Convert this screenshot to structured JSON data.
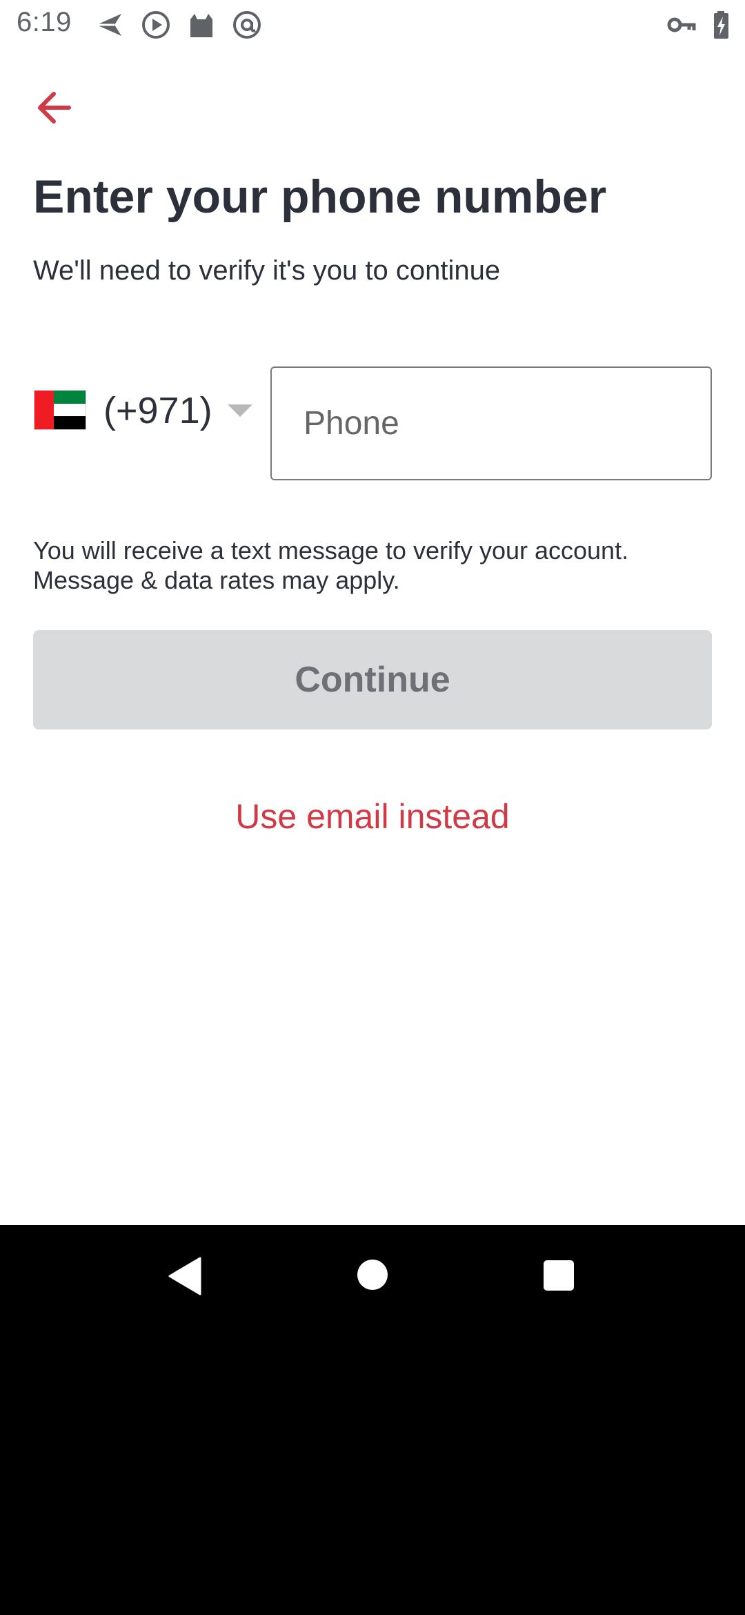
{
  "status_bar": {
    "time": "6:19",
    "left_icons": [
      "send-icon",
      "play-icon",
      "cat-icon",
      "at-sign-icon"
    ],
    "right_icons": [
      "key-icon",
      "battery-charging-icon"
    ]
  },
  "header": {
    "back_icon": "arrow-left-icon"
  },
  "main": {
    "title": "Enter your phone number",
    "subtitle": "We'll need to verify it's you to continue",
    "country": {
      "flag": "uae-flag-icon",
      "code": "(+971)",
      "dropdown_icon": "caret-down-icon"
    },
    "phone": {
      "placeholder": "Phone",
      "value": ""
    },
    "info_line1": "You will receive a text message to verify your account.",
    "info_line2": "Message & data rates may apply.",
    "continue_label": "Continue",
    "email_link_label": "Use email instead"
  },
  "colors": {
    "accent": "#d13a45",
    "title_text": "#2c303b",
    "button_disabled_bg": "#d9dadc",
    "button_disabled_text": "#6e7076"
  },
  "nav_bar": {
    "icons": [
      "nav-back-icon",
      "nav-home-icon",
      "nav-recents-icon"
    ]
  }
}
